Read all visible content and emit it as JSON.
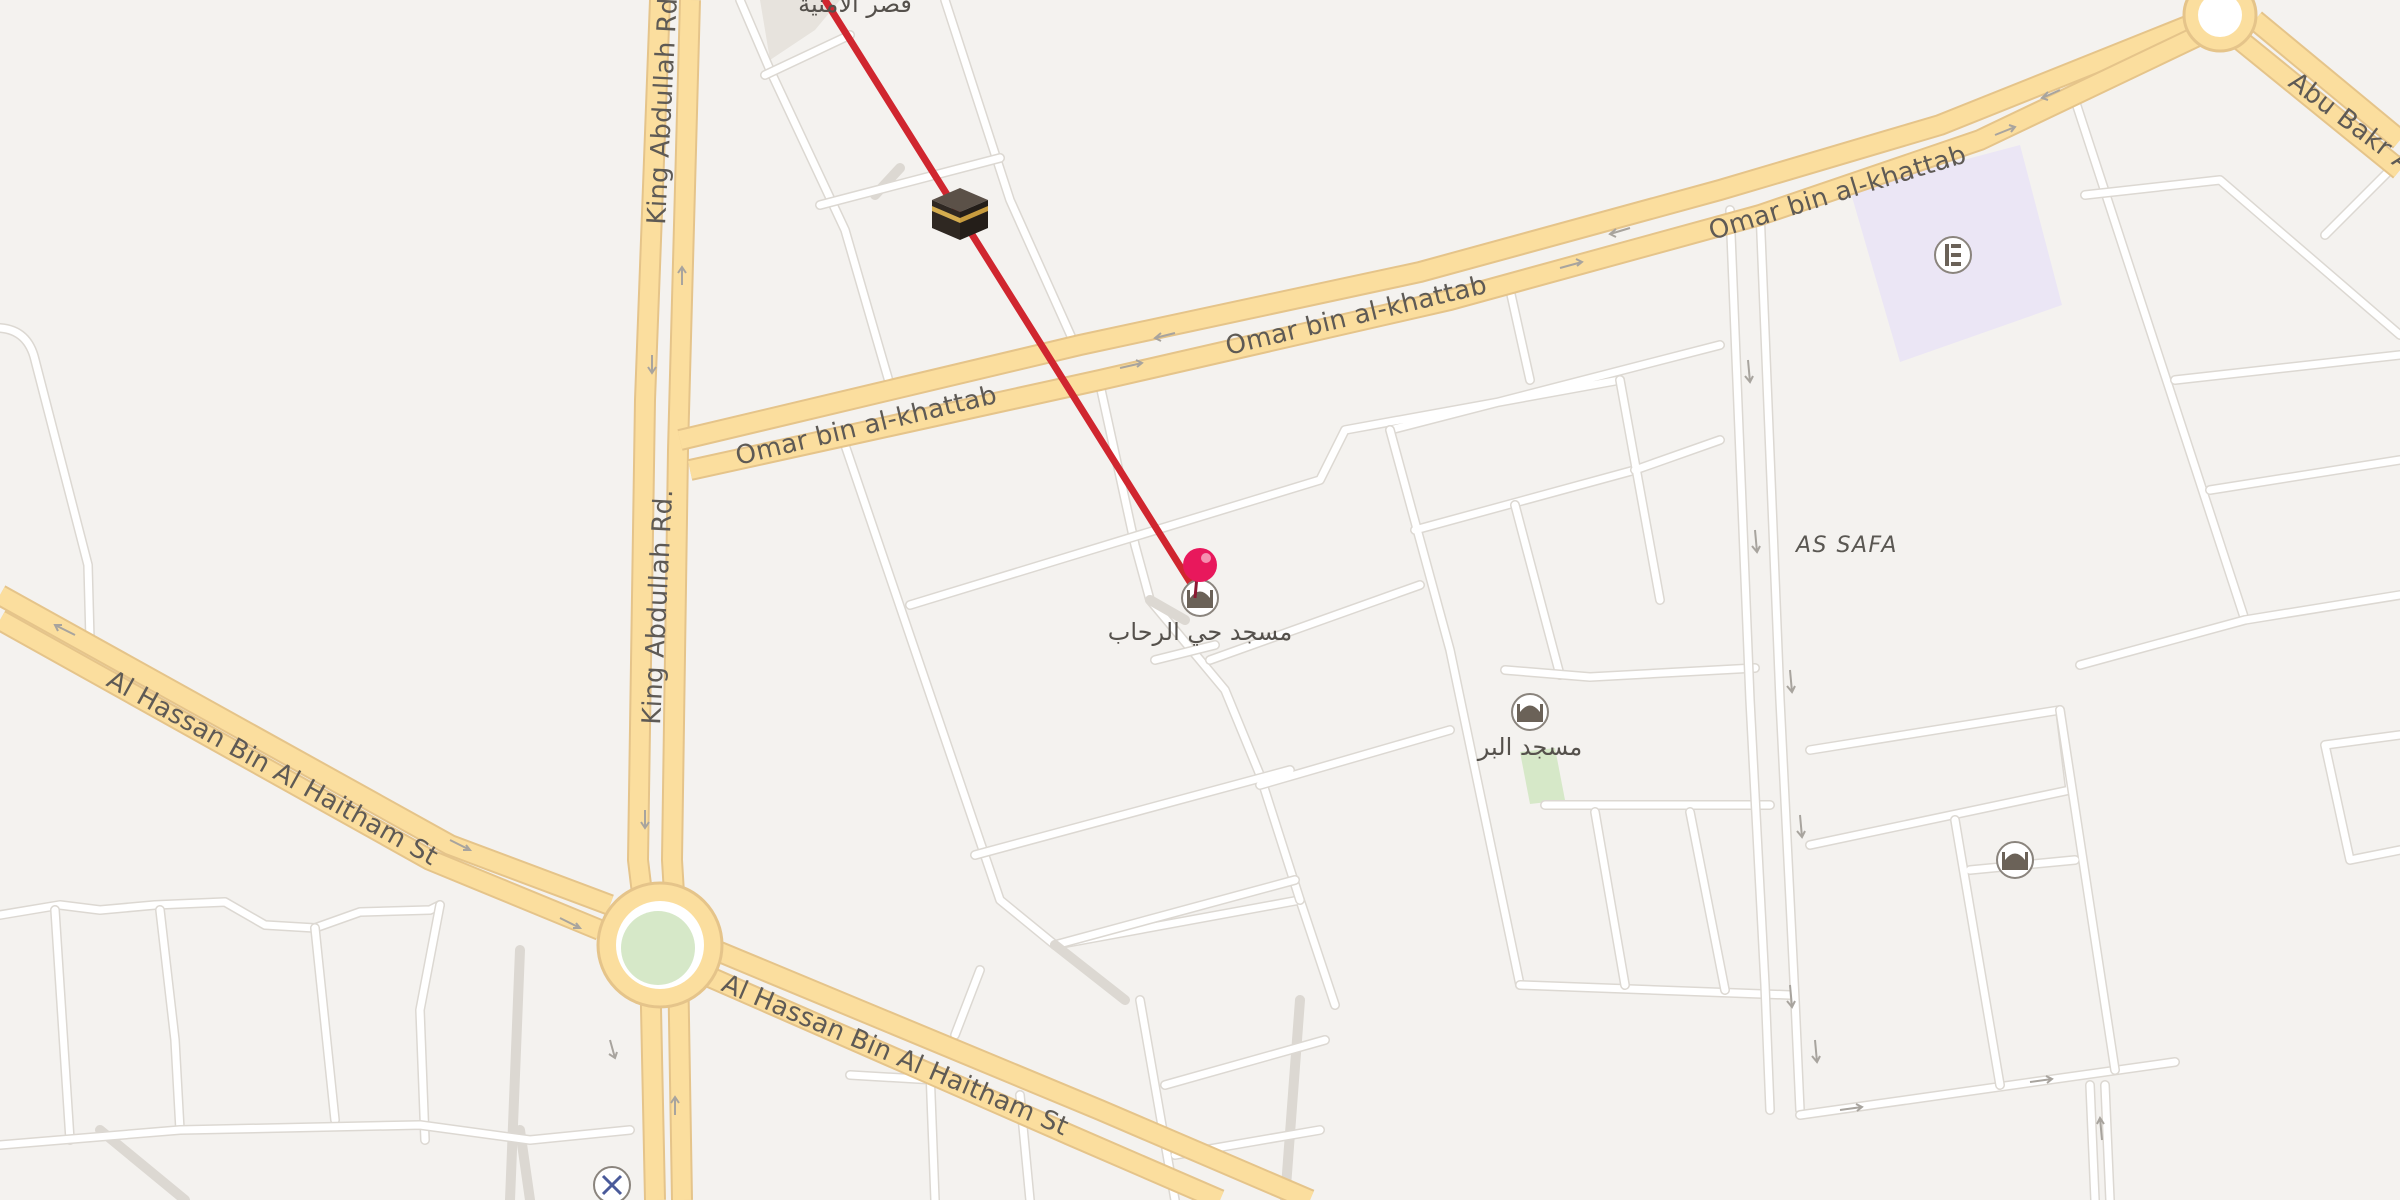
{
  "map": {
    "district": "AS SAFA",
    "roads": {
      "king_abdullah_top": "King Abdullah Rd.",
      "king_abdullah_mid": "King Abdullah Rd.",
      "omar_west": "Omar bin al-khattab",
      "omar_mid": "Omar bin al-khattab",
      "omar_east": "Omar bin al-khattab",
      "hassan_west": "Al Hassan Bin Al Haitham St",
      "hassan_east": "Al Hassan Bin Al Haitham St",
      "abu_bakr": "Abu Bakr Al"
    },
    "pois": {
      "top_clipped": "قصر الأمنية",
      "mosque_rehab": "مسجد حي الرحاب",
      "mosque_albir": "مسجد البر"
    },
    "colors": {
      "main_road": "#fbde9e",
      "route_line": "#d0262f",
      "pin": "#e8185c",
      "background": "#f4f2ef",
      "park": "#d6e8c8",
      "school_area": "#ebe6f5"
    },
    "icons": {
      "kaaba": "kaaba-icon",
      "location_pin": "location-pin-icon",
      "mosque": "mosque-icon",
      "school": "school-icon",
      "barber": "scissors-icon"
    }
  }
}
